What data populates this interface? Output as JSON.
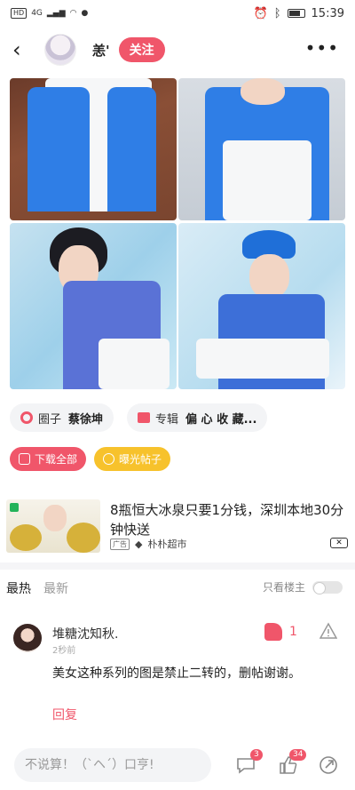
{
  "status_bar": {
    "left_text": "HD",
    "network": "4G",
    "time": "15:39"
  },
  "header": {
    "user_name": "恙'",
    "follow_label": "关注",
    "more_label": "•••"
  },
  "tags": [
    {
      "label": "圈子",
      "value": "蔡徐坤"
    },
    {
      "label": "专辑",
      "value": "偏 心 收 藏..."
    }
  ],
  "actions": {
    "download_label": "下载全部",
    "expose_label": "曝光帖子"
  },
  "ad": {
    "title": "8瓶恒大冰泉只要1分钱，深圳本地30分钟快送",
    "tag": "广告",
    "source": "朴朴超市",
    "close": "✕"
  },
  "comments_section": {
    "tabs": [
      "最热",
      "最新"
    ],
    "only_host_label": "只看楼主",
    "comment": {
      "user": "堆糖沈知秋.",
      "time": "2秒前",
      "text": "美女这种系列的图是禁止二转的，删帖谢谢。",
      "reply_label": "回复",
      "likes": "1"
    }
  },
  "bottom_bar": {
    "input_placeholder": "不说算！（`ヘ´）口亨!",
    "comment_count": "3",
    "like_count": "34"
  },
  "colors": {
    "accent": "#f0566a",
    "expose": "#f7c22c"
  }
}
